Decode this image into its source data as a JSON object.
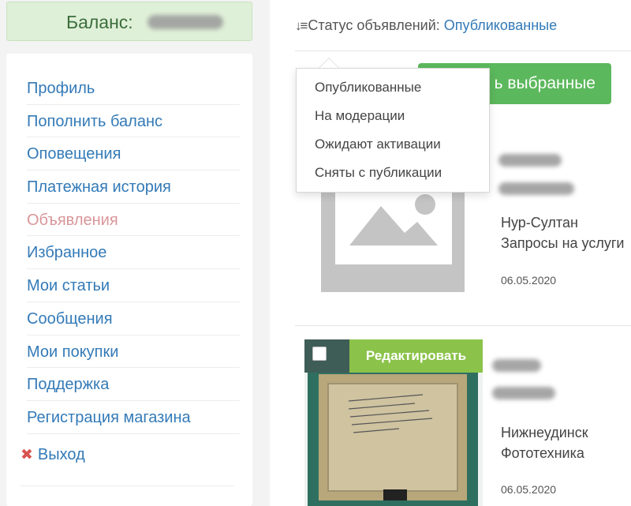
{
  "balance": {
    "label": "Баланс:"
  },
  "sidebar": {
    "items": [
      {
        "label": "Профиль"
      },
      {
        "label": "Пополнить баланс"
      },
      {
        "label": "Оповещения"
      },
      {
        "label": "Платежная история"
      },
      {
        "label": "Объявления"
      },
      {
        "label": "Избранное"
      },
      {
        "label": "Мои статьи"
      },
      {
        "label": "Сообщения"
      },
      {
        "label": "Мои покупки"
      },
      {
        "label": "Поддержка"
      },
      {
        "label": "Регистрация магазина"
      }
    ],
    "logout_label": "Выход"
  },
  "status": {
    "label": "Статус объявлений:",
    "value": "Опубликованные",
    "options": [
      "Опубликованные",
      "На модерации",
      "Ожидают активации",
      "Сняты с публикации"
    ]
  },
  "bulk_action": {
    "label": "ь выбранные"
  },
  "listings": [
    {
      "city": "Нур-Султан",
      "category": "Запросы на услуги",
      "date": "06.05.2020"
    },
    {
      "city": "Нижнеудинск",
      "category": "Фототехника",
      "date": "06.05.2020",
      "edit_label": "Редактировать"
    }
  ],
  "colors": {
    "accent_green": "#5cb85c",
    "edit_green": "#8bc34a",
    "link_blue": "#337ab7",
    "active_pink": "#d9969a",
    "balance_bg": "#dff0d8"
  },
  "icons": [
    "sort-icon",
    "image-placeholder-icon",
    "close-icon",
    "checkbox-icon"
  ]
}
